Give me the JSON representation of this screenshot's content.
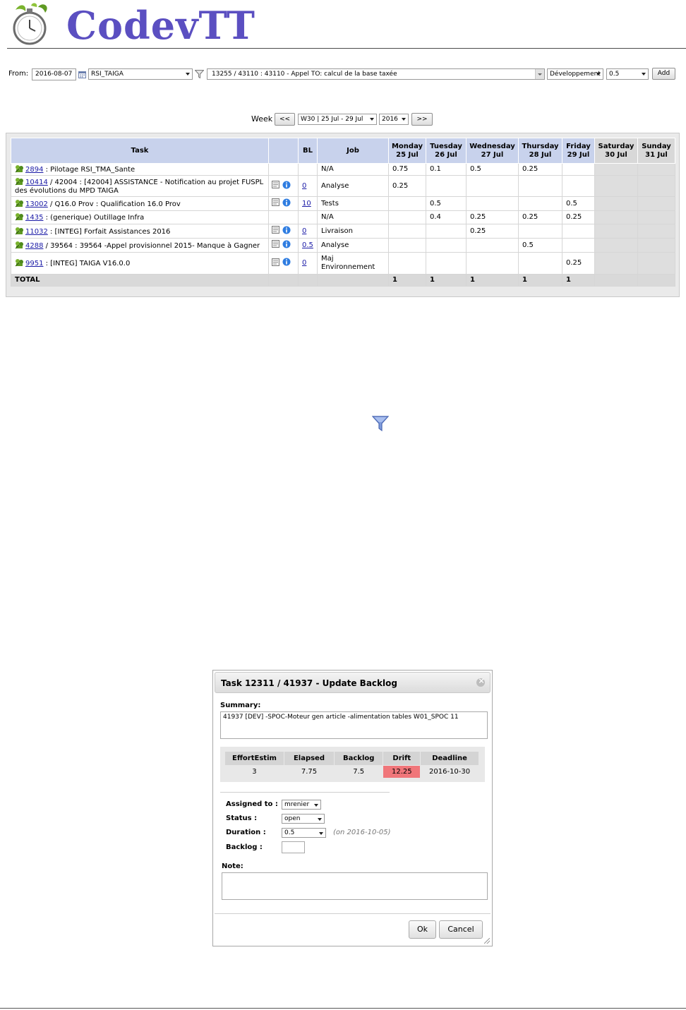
{
  "app": {
    "logo_text": "CodevTT"
  },
  "toolbar": {
    "from_label": "From:",
    "from_date": "2016-08-07",
    "project": "RSI_TAIGA",
    "task": "13255 / 43110 : 43110 - Appel TO: calcul de la base taxée",
    "job": "Développement",
    "duration": "0.5",
    "add_label": "Add"
  },
  "weeknav": {
    "label": "Week",
    "prev_label": "<<",
    "week": "W30 | 25 Jul - 29 Jul",
    "year": "2016",
    "next_label": ">>"
  },
  "timesheet": {
    "headers": {
      "task": "Task",
      "bl": "BL",
      "job": "Job",
      "days": [
        {
          "name": "Monday",
          "date": "25 Jul"
        },
        {
          "name": "Tuesday",
          "date": "26 Jul"
        },
        {
          "name": "Wednesday",
          "date": "27 Jul"
        },
        {
          "name": "Thursday",
          "date": "28 Jul"
        },
        {
          "name": "Friday",
          "date": "29 Jul"
        },
        {
          "name": "Saturday",
          "date": "30 Jul"
        },
        {
          "name": "Sunday",
          "date": "31 Jul"
        }
      ]
    },
    "rows": [
      {
        "id": "2894",
        "desc": " : Pilotage RSI_TMA_Sante",
        "icons": false,
        "bl": "",
        "job": "N/A",
        "days": [
          "0.75",
          "0.1",
          "0.5",
          "0.25",
          "",
          "",
          ""
        ]
      },
      {
        "id": "10414",
        "desc": " / 42004 : [42004] ASSISTANCE - Notification au projet FUSPL des évolutions du MPD TAIGA",
        "icons": true,
        "bl": "0",
        "job": "Analyse",
        "days": [
          "0.25",
          "",
          "",
          "",
          "",
          "",
          ""
        ]
      },
      {
        "id": "13002",
        "desc": " / Q16.0 Prov : Qualification 16.0 Prov",
        "icons": true,
        "bl": "10",
        "job": "Tests",
        "days": [
          "",
          "0.5",
          "",
          "",
          "0.5",
          "",
          ""
        ]
      },
      {
        "id": "1435",
        "desc": " : (generique) Outillage Infra",
        "icons": false,
        "bl": "",
        "job": "N/A",
        "days": [
          "",
          "0.4",
          "0.25",
          "0.25",
          "0.25",
          "",
          ""
        ]
      },
      {
        "id": "11032",
        "desc": " : [INTEG] Forfait Assistances 2016",
        "icons": true,
        "bl": "0",
        "job": "Livraison",
        "days": [
          "",
          "",
          "0.25",
          "",
          "",
          "",
          ""
        ]
      },
      {
        "id": "4288",
        "desc": " / 39564 : 39564 -Appel provisionnel 2015- Manque à Gagner",
        "icons": true,
        "bl": "0.5",
        "job": "Analyse",
        "days": [
          "",
          "",
          "",
          "0.5",
          "",
          "",
          ""
        ]
      },
      {
        "id": "9951",
        "desc": " : [INTEG] TAIGA V16.0.0",
        "icons": true,
        "bl": "0",
        "job": "Maj Environnement",
        "days": [
          "",
          "",
          "",
          "",
          "0.25",
          "",
          ""
        ]
      }
    ],
    "total": {
      "label": "TOTAL",
      "days": [
        "1",
        "1",
        "1",
        "1",
        "1",
        "",
        ""
      ]
    }
  },
  "dialog": {
    "title": "Task 12311 / 41937 - Update Backlog",
    "summary_label": "Summary:",
    "summary": "41937 [DEV] -SPOC-Moteur gen article -alimentation tables W01_SPOC 11",
    "stats_headers": [
      "EffortEstim",
      "Elapsed",
      "Backlog",
      "Drift",
      "Deadline"
    ],
    "stats_values": [
      "3",
      "7.75",
      "7.5",
      "12.25",
      "2016-10-30"
    ],
    "assigned_label": "Assigned to :",
    "assigned": "mrenier",
    "status_label": "Status :",
    "status": "open",
    "duration_label": "Duration :",
    "duration": "0.5",
    "duration_note": "(on 2016-10-05)",
    "backlog_label": "Backlog :",
    "backlog": "",
    "note_label": "Note:",
    "ok_label": "Ok",
    "cancel_label": "Cancel"
  },
  "colors": {
    "header_bg": "#c8d2ec",
    "weekend_bg": "#dedede",
    "drift_bg": "#f0767a",
    "logo": "#5b4fc1",
    "link": "#1a1aa6"
  }
}
